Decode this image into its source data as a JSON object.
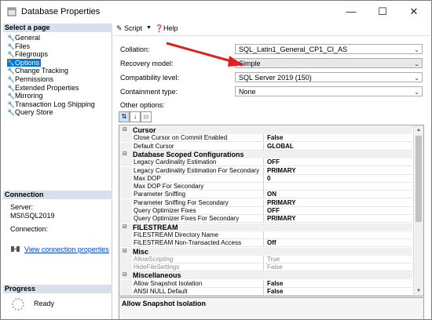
{
  "window": {
    "title": "Database Properties"
  },
  "left_panel": {
    "select_page_header": "Select a page",
    "pages": [
      "General",
      "Files",
      "Filegroups",
      "Options",
      "Change Tracking",
      "Permissions",
      "Extended Properties",
      "Mirroring",
      "Transaction Log Shipping",
      "Query Store"
    ],
    "selected_page": "Options",
    "connection_header": "Connection",
    "server_label": "Server:",
    "server_value": "MSI\\SQL2019",
    "connection_label": "Connection:",
    "view_connection_link": "View connection properties",
    "progress_header": "Progress",
    "progress_status": "Ready"
  },
  "toolbar": {
    "script_label": "Script",
    "help_label": "Help"
  },
  "form": {
    "collation_label": "Collation:",
    "collation_value": "SQL_Latin1_General_CP1_CI_AS",
    "recovery_label": "Recovery model:",
    "recovery_value": "Simple",
    "compat_label": "Compatibility level:",
    "compat_value": "SQL Server 2019 (150)",
    "containment_label": "Containment type:",
    "containment_value": "None",
    "other_options_label": "Other options:"
  },
  "grid": {
    "rows": [
      {
        "type": "cat",
        "name": "Cursor"
      },
      {
        "type": "prop",
        "name": "Close Cursor on Commit Enabled",
        "value": "False"
      },
      {
        "type": "prop",
        "name": "Default Cursor",
        "value": "GLOBAL"
      },
      {
        "type": "cat",
        "name": "Database Scoped Configurations"
      },
      {
        "type": "prop",
        "name": "Legacy Cardinality Estimation",
        "value": "OFF"
      },
      {
        "type": "prop",
        "name": "Legacy Cardinality Estimation For Secondary",
        "value": "PRIMARY"
      },
      {
        "type": "prop",
        "name": "Max DOP",
        "value": "0"
      },
      {
        "type": "prop",
        "name": "Max DOP For Secondary",
        "value": ""
      },
      {
        "type": "prop",
        "name": "Parameter Sniffing",
        "value": "ON"
      },
      {
        "type": "prop",
        "name": "Parameter Sniffing For Secondary",
        "value": "PRIMARY"
      },
      {
        "type": "prop",
        "name": "Query Optimizer Fixes",
        "value": "OFF"
      },
      {
        "type": "prop",
        "name": "Query Optimizer Fixes For Secondary",
        "value": "PRIMARY"
      },
      {
        "type": "cat",
        "name": "FILESTREAM"
      },
      {
        "type": "prop",
        "name": "FILESTREAM Directory Name",
        "value": ""
      },
      {
        "type": "prop",
        "name": "FILESTREAM Non-Transacted Access",
        "value": "Off"
      },
      {
        "type": "cat",
        "name": "Misc"
      },
      {
        "type": "prop",
        "name": "AllowScripting",
        "value": "True",
        "disabled": true
      },
      {
        "type": "prop",
        "name": "HideFileSettings",
        "value": "False",
        "disabled": true
      },
      {
        "type": "cat",
        "name": "Miscellaneous"
      },
      {
        "type": "prop",
        "name": "Allow Snapshot Isolation",
        "value": "False"
      },
      {
        "type": "prop",
        "name": "ANSI NULL Default",
        "value": "False"
      }
    ]
  },
  "description": {
    "title": "Allow Snapshot Isolation"
  },
  "colors": {
    "selection": "#0078d7",
    "header_bg": "#d7e1ee",
    "annotation_arrow": "#e02020"
  }
}
